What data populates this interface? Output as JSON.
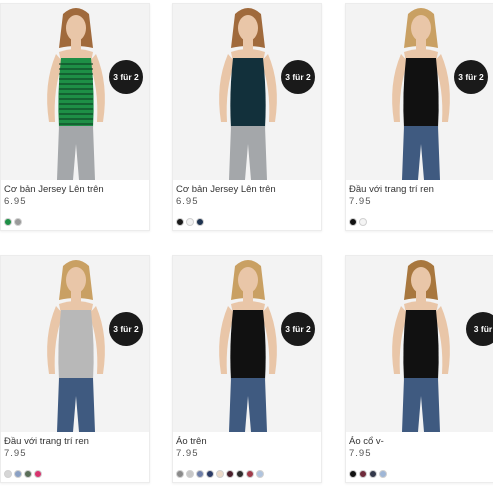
{
  "products": [
    {
      "title": "Cơ bản Jersey Lên trên",
      "price": "6.95",
      "badge": "3 für 2",
      "top_color": "#1e8f46",
      "top_stripes": true,
      "pants_color": "#a4a7aa",
      "hair_color": "#a06a3c",
      "swatches": [
        "#1e8f46",
        "#9a9a9a"
      ]
    },
    {
      "title": "Cơ bản Jersey Lên trên",
      "price": "6.95",
      "badge": "3 für 2",
      "top_color": "#12303b",
      "top_stripes": false,
      "pants_color": "#a4a7aa",
      "hair_color": "#a06a3c",
      "swatches": [
        "#1a1a1a",
        "#f2f2f2",
        "#1f3350"
      ]
    },
    {
      "title": "Đầu với trang trí ren",
      "price": "7.95",
      "badge": "3 für 2",
      "top_color": "#111111",
      "top_stripes": false,
      "pants_color": "#3f5a80",
      "hair_color": "#c9a063",
      "swatches": [
        "#111111",
        "#f4f4f4"
      ]
    },
    {
      "title": "Đầu với trang trí ren",
      "price": "7.95",
      "badge": "3 für 2",
      "top_color": "#b8b8b8",
      "top_stripes": false,
      "pants_color": "#3f5a80",
      "hair_color": "#c9a063",
      "swatches": [
        "#d6d6d6",
        "#8aa0c4",
        "#5a6e58",
        "#d8336e"
      ]
    },
    {
      "title": "Áo trên",
      "price": "7.95",
      "badge": "3 für 2",
      "top_color": "#111111",
      "top_stripes": false,
      "pants_color": "#3f5a80",
      "hair_color": "#c9a063",
      "swatches": [
        "#8a8a8a",
        "#c7c7c7",
        "#6f7fa8",
        "#2b3b66",
        "#ead9c8",
        "#4a1f2c",
        "#2c2c2c",
        "#a13b4a",
        "#b0c4de"
      ]
    },
    {
      "title": "Áo cổ v-",
      "price": "7.95",
      "badge": "3 für",
      "top_color": "#111111",
      "top_stripes": false,
      "pants_color": "#3f5a80",
      "hair_color": "#a8773e",
      "swatches": [
        "#111111",
        "#6e2a3a",
        "#33384a",
        "#9fb6d6"
      ]
    }
  ]
}
